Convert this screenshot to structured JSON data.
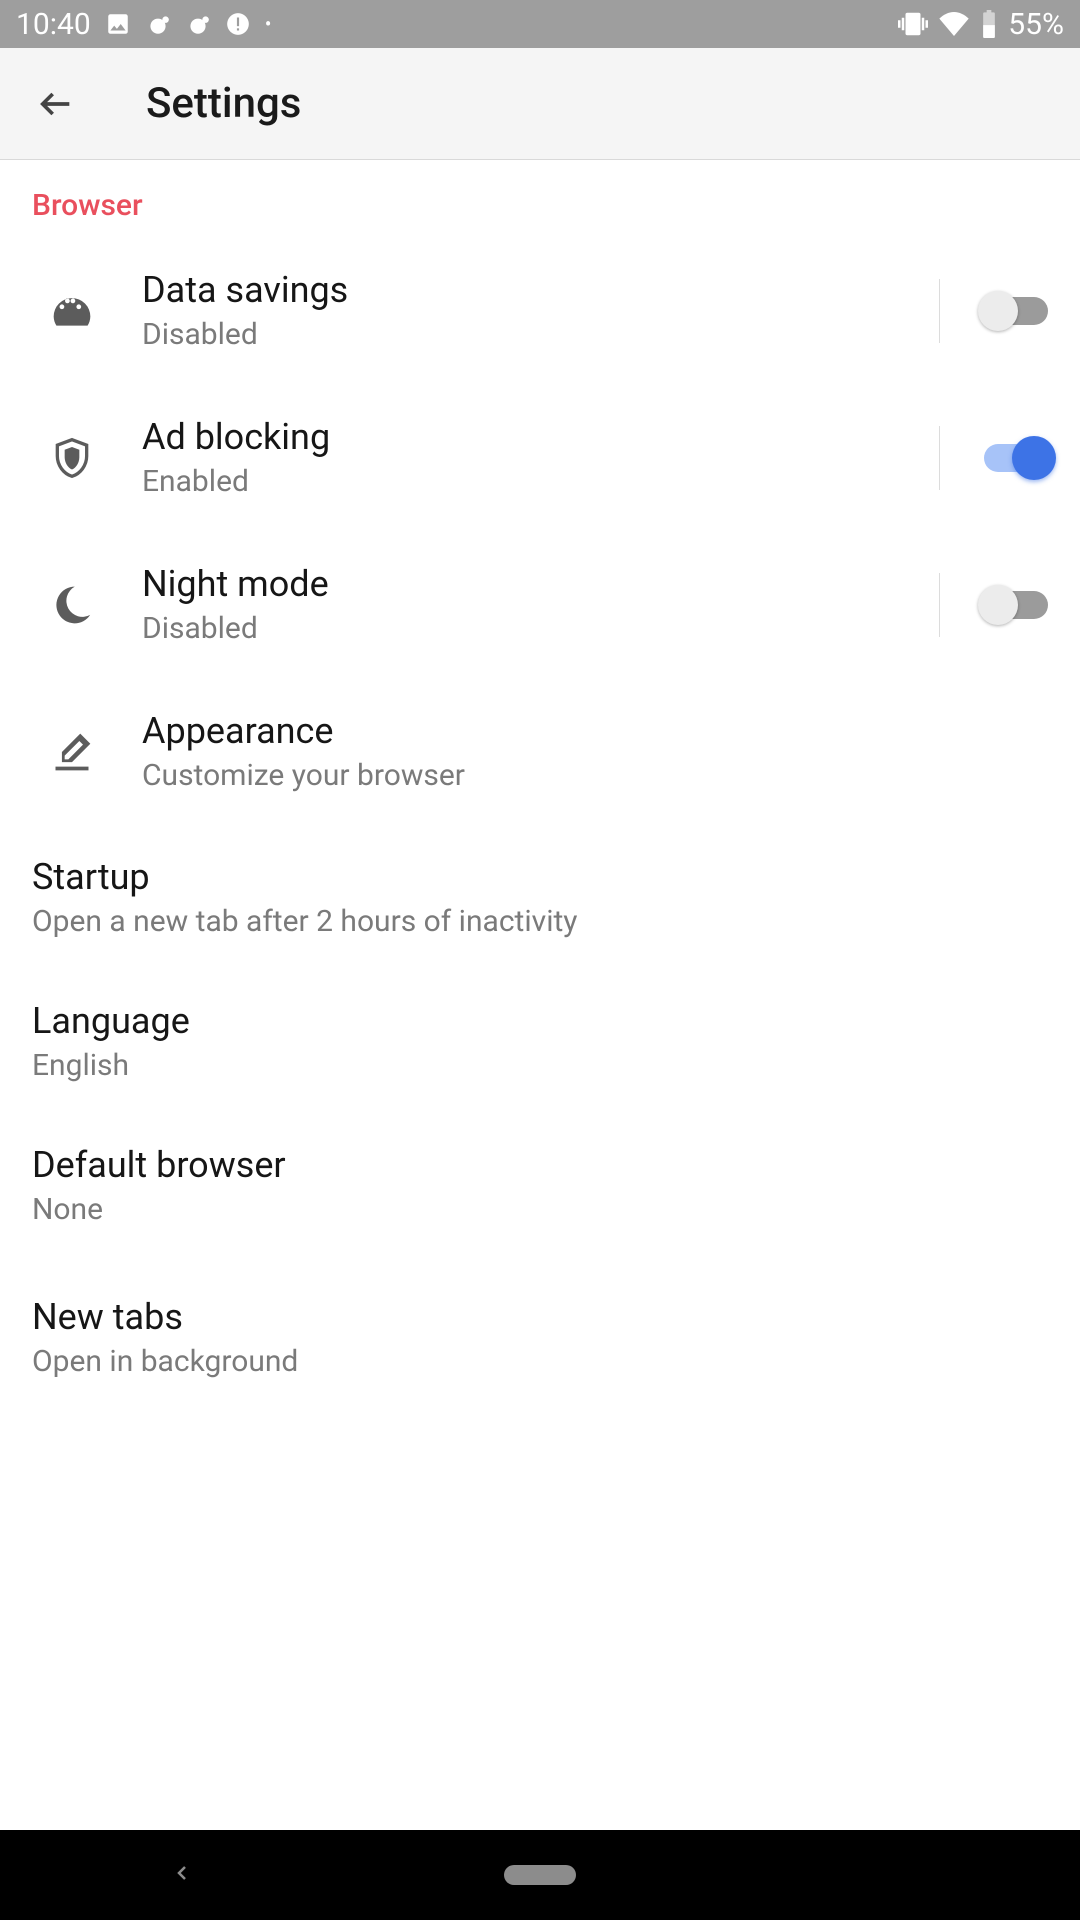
{
  "status": {
    "time": "10:40",
    "battery": "55%"
  },
  "header": {
    "title": "Settings"
  },
  "section": {
    "label": "Browser"
  },
  "items": {
    "data_savings": {
      "title": "Data savings",
      "sub": "Disabled",
      "on": false
    },
    "ad_blocking": {
      "title": "Ad blocking",
      "sub": "Enabled",
      "on": true
    },
    "night_mode": {
      "title": "Night mode",
      "sub": "Disabled",
      "on": false
    },
    "appearance": {
      "title": "Appearance",
      "sub": "Customize your browser"
    },
    "startup": {
      "title": "Startup",
      "sub": "Open a new tab after 2 hours of inactivity"
    },
    "language": {
      "title": "Language",
      "sub": "English"
    },
    "default_browser": {
      "title": "Default browser",
      "sub": "None"
    },
    "new_tabs": {
      "title": "New tabs",
      "sub": "Open in background"
    }
  }
}
